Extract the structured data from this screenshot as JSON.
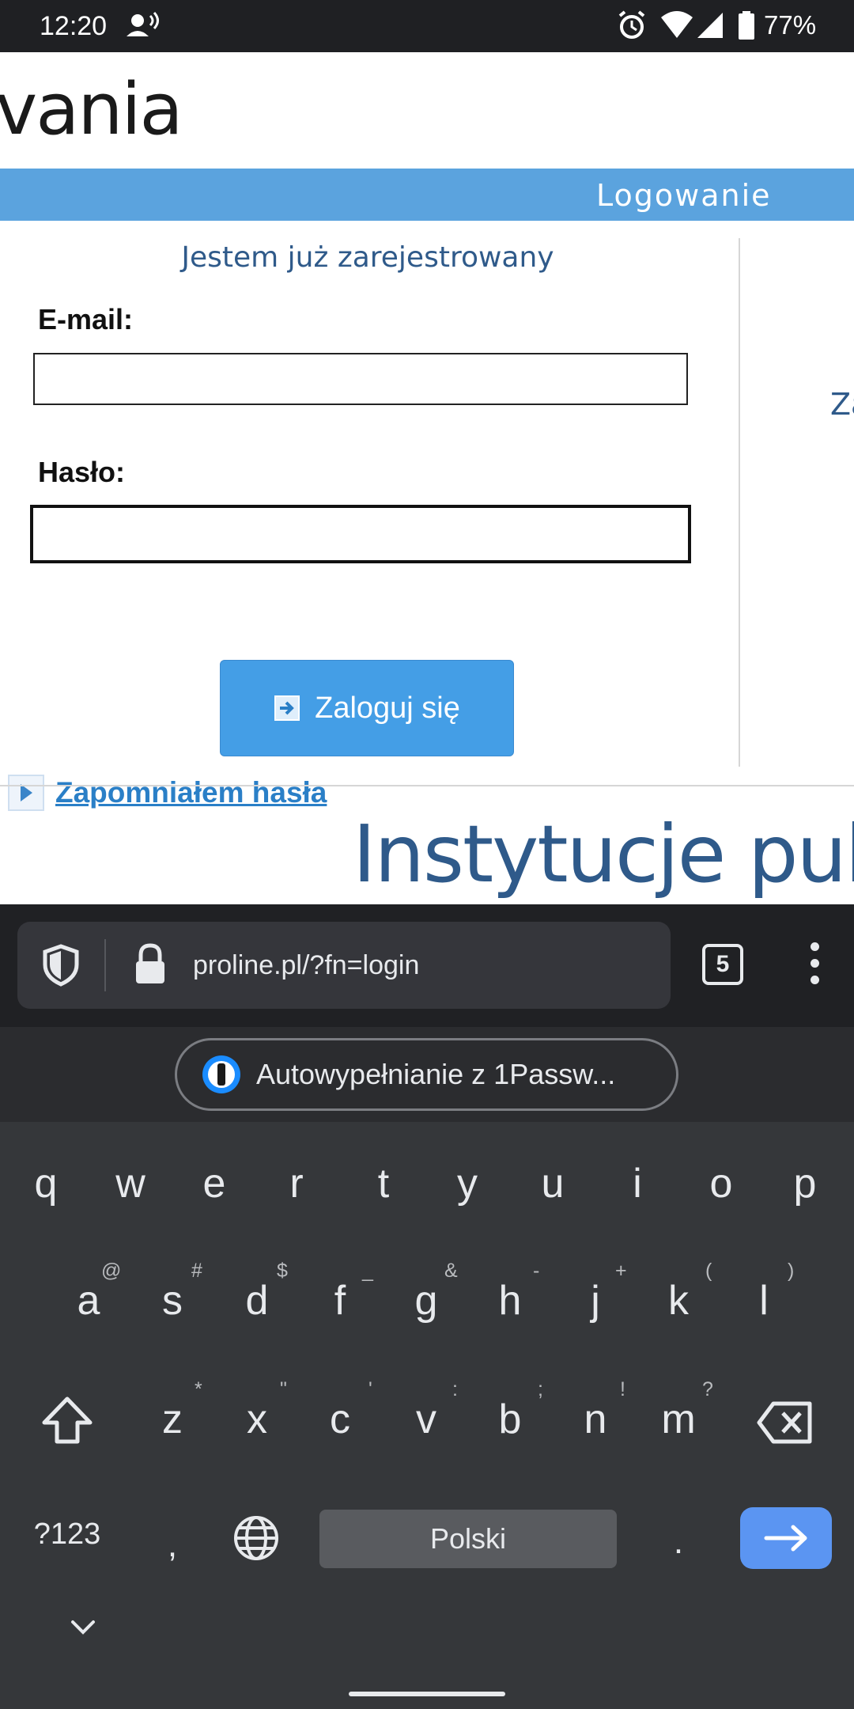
{
  "status_bar": {
    "time": "12:20",
    "battery": "77%"
  },
  "page": {
    "heading_fragment": "vania",
    "section_bar_label": "Logowanie",
    "subheading": "Jestem już zarejestrowany",
    "right_fragment": "Za",
    "email_label": "E-mail:",
    "password_label": "Hasło:",
    "login_button": "Zaloguj się",
    "forgot_link": "Zapomniałem hasła",
    "big_title": "Instytucje public"
  },
  "browser": {
    "url": "proline.pl/?fn=login",
    "tab_count": "5"
  },
  "autofill": {
    "label": "Autowypełnianie z 1Passw..."
  },
  "keyboard": {
    "row1": [
      "q",
      "w",
      "e",
      "r",
      "t",
      "y",
      "u",
      "i",
      "o",
      "p"
    ],
    "row2": [
      "a",
      "s",
      "d",
      "f",
      "g",
      "h",
      "j",
      "k",
      "l"
    ],
    "row2_hints": [
      "@",
      "#",
      "$",
      "_",
      "&",
      "-",
      "+",
      "(",
      ")"
    ],
    "row3": [
      "z",
      "x",
      "c",
      "v",
      "b",
      "n",
      "m"
    ],
    "row3_hints": [
      "*",
      "\"",
      "'",
      ":",
      ";",
      "!",
      "?"
    ],
    "symbols_key": "?123",
    "comma": ",",
    "period": ".",
    "space_label": "Polski"
  },
  "colors": {
    "accent_blue": "#5ba3de",
    "button_blue": "#449ee6",
    "link_blue": "#2a7fc7",
    "keyboard_bg": "#35373a"
  }
}
